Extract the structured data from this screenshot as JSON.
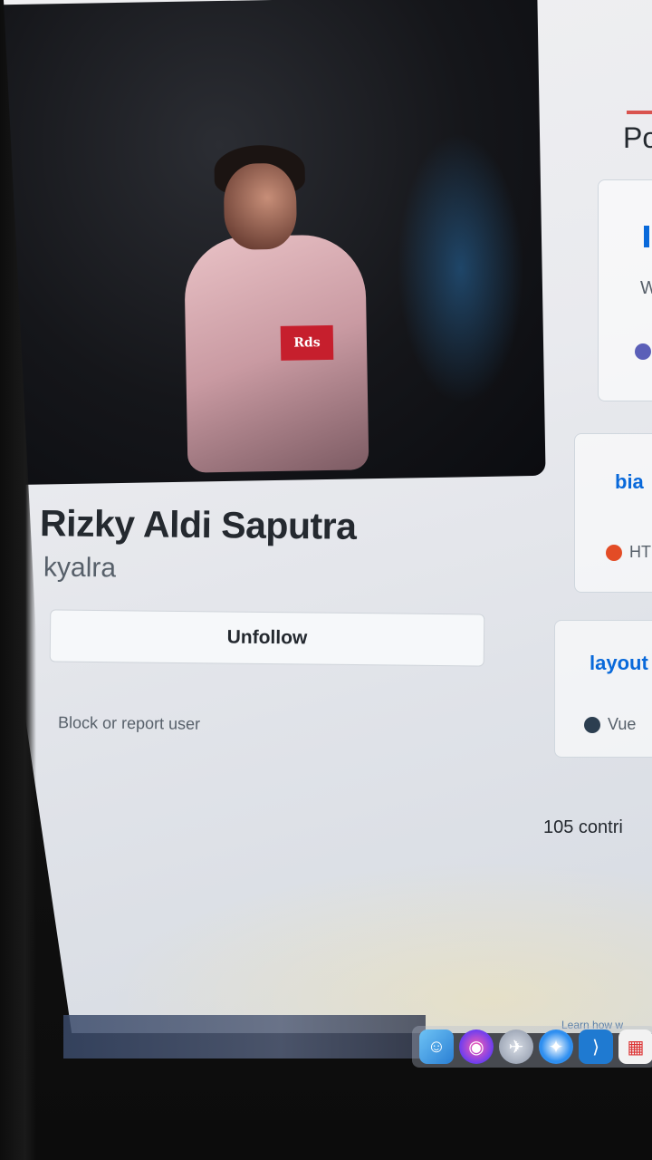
{
  "profile": {
    "full_name": "Rizky Aldi Saputra",
    "username": "kyalra",
    "unfollow_label": "Unfollow",
    "block_label": "Block or report user",
    "avatar_badge_text": "Rds"
  },
  "right_column": {
    "tab_label": "Po",
    "repos": [
      {
        "name": "",
        "description": "W",
        "language": "",
        "language_color": "#5b5fb8"
      },
      {
        "name": "bia",
        "language": "HT",
        "language_color": "#e34c26"
      },
      {
        "name": "layout",
        "language": "Vue",
        "language_color": "#2c3e50"
      }
    ],
    "contributions_label": "105 contri",
    "learn_more_label": "Learn how w"
  },
  "dock": {
    "icons": [
      "finder-icon",
      "siri-icon",
      "launchpad-icon",
      "safari-icon",
      "vscode-icon",
      "calendar-icon"
    ]
  },
  "colors": {
    "link": "#0969da",
    "text_primary": "#24292f",
    "text_secondary": "#57606a",
    "tab_accent": "#d9534f"
  }
}
